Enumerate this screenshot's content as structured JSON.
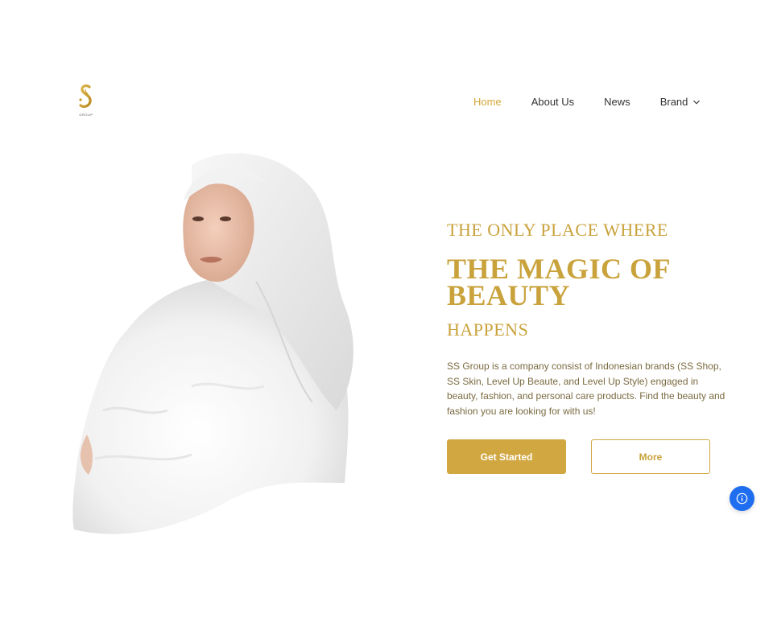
{
  "brand": {
    "logo_letters": "SS",
    "logo_subtext": "GROUP",
    "accent_color": "#d1a741"
  },
  "nav": {
    "items": [
      {
        "label": "Home",
        "active": true
      },
      {
        "label": "About Us",
        "active": false
      },
      {
        "label": "News",
        "active": false
      },
      {
        "label": "Brand",
        "active": false,
        "icon": "chevron-down-icon"
      }
    ]
  },
  "hero": {
    "kicker": "THE ONLY PLACE WHERE",
    "headline": "THE MAGIC OF BEAUTY",
    "subhead": "HAPPENS",
    "description": "SS Group is a company consist of Indonesian brands (SS Shop, SS Skin, Level Up Beaute, and Level Up Style) engaged in beauty, fashion, and personal care products. Find the beauty and fashion you are looking for with us!",
    "primary_button": "Get Started",
    "secondary_button": "More",
    "image": "woman-in-white-hijab-and-fur-coat"
  },
  "fab": {
    "icon": "info-icon",
    "color": "#1f6ef0"
  }
}
